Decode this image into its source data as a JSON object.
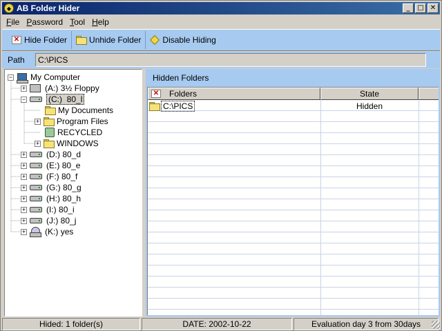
{
  "window": {
    "title": "AB Folder Hider",
    "minimize": "_",
    "maximize": "□",
    "close": "✕"
  },
  "menu": [
    {
      "first": "F",
      "rest": "ile"
    },
    {
      "first": "P",
      "rest": "assword"
    },
    {
      "first": "T",
      "rest": "ool"
    },
    {
      "first": "H",
      "rest": "elp"
    }
  ],
  "toolbar": {
    "hide_label": "Hide Folder",
    "unhide_label": "Unhide Folder",
    "disable_label": "Disable Hiding"
  },
  "path": {
    "label": "Path",
    "value": "C:\\PICS"
  },
  "tree": {
    "root": "My Computer",
    "items": [
      {
        "drive": "(A:)",
        "name": "3½ Floppy"
      },
      {
        "drive": "(C:)",
        "name": "80_l"
      },
      {
        "name": "My Documents"
      },
      {
        "name": "Program Files"
      },
      {
        "name": "RECYCLED"
      },
      {
        "name": "WINDOWS"
      },
      {
        "drive": "(D:)",
        "name": "80_d"
      },
      {
        "drive": "(E:)",
        "name": "80_e"
      },
      {
        "drive": "(F:)",
        "name": "80_f"
      },
      {
        "drive": "(G:)",
        "name": "80_g"
      },
      {
        "drive": "(H:)",
        "name": "80_h"
      },
      {
        "drive": "(I:)",
        "name": "80_i"
      },
      {
        "drive": "(J:)",
        "name": "80_j"
      },
      {
        "drive": "(K:)",
        "name": "yes"
      }
    ]
  },
  "hidden_panel": {
    "title": "Hidden Folders",
    "columns": [
      "Folders",
      "State"
    ],
    "rows": [
      {
        "folder": "C:\\PICS",
        "state": "Hidden"
      }
    ]
  },
  "status": {
    "hided": "Hided: 1 folder(s)",
    "date": "DATE: 2002-10-22",
    "evaluation": "Evaluation day 3 from 30days"
  }
}
